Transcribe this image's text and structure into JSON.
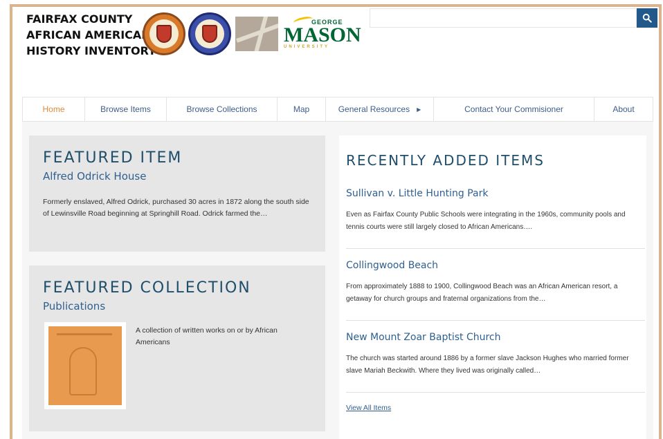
{
  "header": {
    "title_lines": [
      "FAIRFAX COUNTY",
      "AFRICAN AMERICAN",
      "HISTORY INVENTORY"
    ],
    "gmu_logo": {
      "top": "GEORGE",
      "main": "MASON",
      "sub": "UNIVERSITY"
    }
  },
  "search": {
    "value": "",
    "placeholder": ""
  },
  "nav": {
    "items": [
      {
        "label": "Home",
        "active": true
      },
      {
        "label": "Browse Items"
      },
      {
        "label": "Browse Collections"
      },
      {
        "label": "Map"
      },
      {
        "label": "General Resources",
        "has_submenu": true
      },
      {
        "label": "Contact Your Commisioner"
      },
      {
        "label": "About"
      }
    ]
  },
  "featured_item": {
    "heading": "FEATURED ITEM",
    "title": "Alfred Odrick House",
    "text": "Formerly enslaved, Alfred Odrick, purchased 30 acres in 1872 along the south side of Lewinsville Road beginning at Springhill Road. Odrick farmed the…"
  },
  "featured_collection": {
    "heading": "FEATURED COLLECTION",
    "title": "Publications",
    "text": "A collection of written works on or by African Americans"
  },
  "recent": {
    "heading": "RECENTLY ADDED ITEMS",
    "items": [
      {
        "title": "Sullivan v. Little Hunting Park",
        "text": "Even as Fairfax County Public Schools were integrating in the 1960s, community pools and tennis courts were still largely closed to African Americans…."
      },
      {
        "title": "Collingwood Beach",
        "text": "From approximately 1888 to 1900, Collingwood Beach was an African American resort, a getaway for church groups and fraternal organizations from the…"
      },
      {
        "title": "New Mount Zoar Baptist Church",
        "text": "The church was started around 1886 by a former slave Jackson Hughes who married former slave Mariah Beckwith. Where they lived was originally called…"
      }
    ],
    "view_all": "View All Items"
  },
  "colors": {
    "frame": "#d9b48f",
    "nav_text": "#3d5e8a",
    "nav_active": "#e08a3c",
    "heading": "#1f4e6b",
    "link": "#2f5f8f",
    "search_button": "#22598a"
  },
  "icons": {
    "search": "search-icon"
  }
}
